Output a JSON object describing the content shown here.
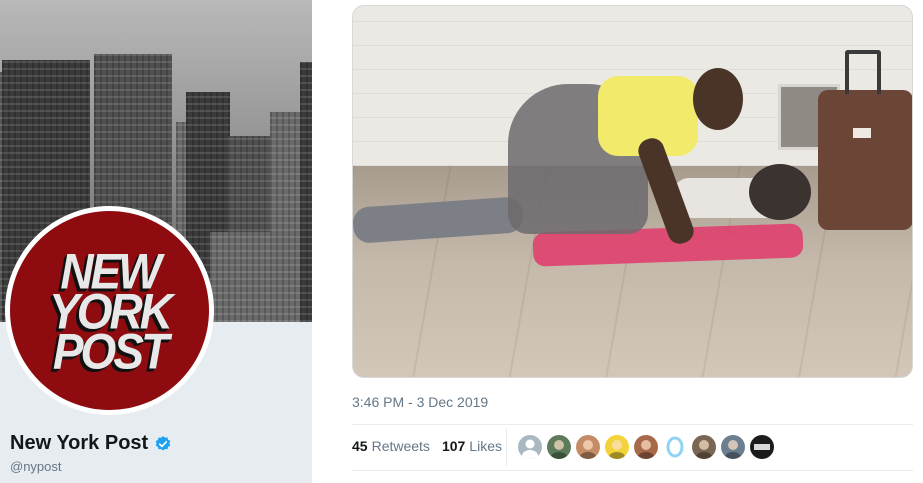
{
  "profile": {
    "name": "New York Post",
    "handle": "@nypost",
    "verified": true,
    "logo_lines": [
      "NEW",
      "YORK",
      "POST"
    ],
    "logo_color": "#8e0b10"
  },
  "tweet": {
    "timestamp": "3:46 PM - 3 Dec 2019",
    "retweets": {
      "count": "45",
      "label": "Retweets"
    },
    "likes": {
      "count": "107",
      "label": "Likes"
    },
    "liker_avatars": [
      {
        "icon": "default-avatar-icon",
        "color": "#aab8c2"
      },
      {
        "icon": "landscape-avatar-icon",
        "color": "#5d7a5a"
      },
      {
        "icon": "face-avatar-icon",
        "color": "#c48c66"
      },
      {
        "icon": "cartoon-avatar-icon",
        "color": "#f2d33b"
      },
      {
        "icon": "face-avatar-icon",
        "color": "#a8694a"
      },
      {
        "icon": "ring-avatar-icon",
        "color": "#8fd3f5"
      },
      {
        "icon": "face-avatar-icon",
        "color": "#7a6654"
      },
      {
        "icon": "person-avatar-icon",
        "color": "#6b7f90"
      },
      {
        "icon": "logo-avatar-icon",
        "color": "#1b1b1b"
      }
    ]
  },
  "colors": {
    "accent": "#1da1f2",
    "muted_text": "#657786",
    "panel": "#e6ecf0"
  }
}
